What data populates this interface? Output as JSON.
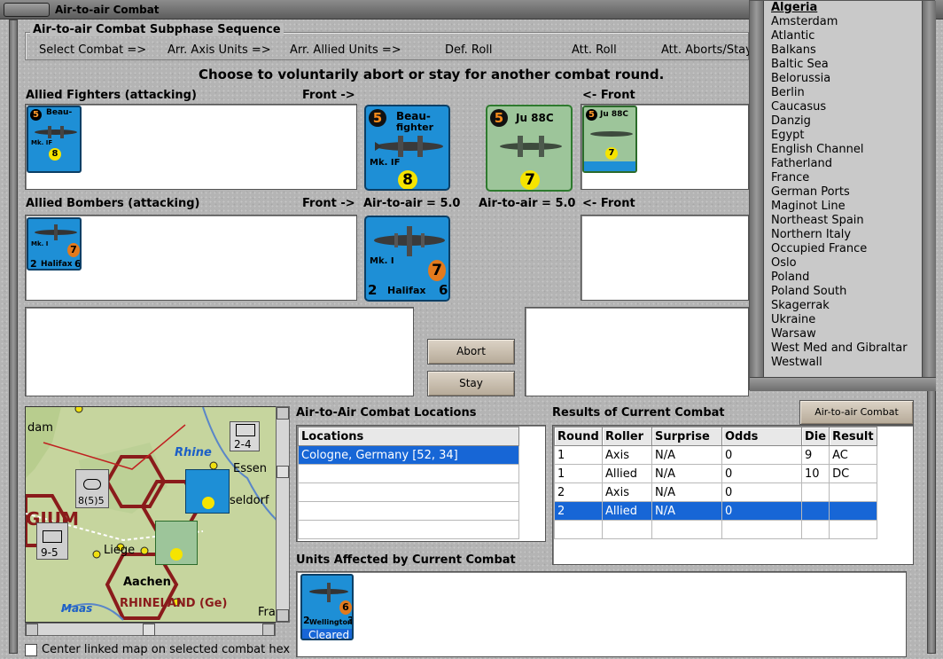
{
  "window": {
    "title": "Air-to-air Combat"
  },
  "sequence": {
    "legend": "Air-to-air Combat Subphase Sequence",
    "steps": [
      "Select Combat =>",
      "Arr. Axis Units =>",
      "Arr. Allied Units =>",
      "Def. Roll",
      "Att. Roll",
      "Att. Aborts/Stay"
    ]
  },
  "instruction": "Choose to voluntarily abort or stay for another combat round.",
  "allied_fighters": {
    "label": "Allied Fighters (attacking)",
    "front_label": "Front ->",
    "counter": {
      "name_line1": "Beau-",
      "name_line2": "fighter",
      "model": "Mk. IF",
      "rating": "5",
      "value": "8"
    }
  },
  "axis_fighter": {
    "front_label": "<- Front",
    "counter": {
      "name": "Ju 88C",
      "rating": "5",
      "value": "7"
    }
  },
  "allied_bombers": {
    "label": "Allied Bombers (attacking)",
    "front_label": "Front ->",
    "air_to_air_left": "Air-to-air = 5.0",
    "air_to_air_right": "Air-to-air = 5.0",
    "right_front_label": "<- Front",
    "counter": {
      "name": "Halifax",
      "model": "Mk. I",
      "left": "2",
      "right": "6",
      "value": "7"
    }
  },
  "buttons": {
    "abort": "Abort",
    "stay": "Stay",
    "chart": "Air-to-air Combat Chart"
  },
  "locations": {
    "title": "Air-to-Air Combat Locations",
    "header": "Locations",
    "rows": [
      "Cologne, Germany [52, 34]"
    ]
  },
  "results": {
    "title": "Results of Current Combat",
    "columns": [
      "Round",
      "Roller",
      "Surprise",
      "Odds",
      "Die",
      "Result"
    ],
    "rows": [
      [
        "1",
        "Axis",
        "N/A",
        "0",
        "9",
        "AC"
      ],
      [
        "1",
        "Allied",
        "N/A",
        "0",
        "10",
        "DC"
      ],
      [
        "2",
        "Axis",
        "N/A",
        "0",
        "",
        ""
      ],
      [
        "2",
        "Allied",
        "N/A",
        "0",
        "",
        ""
      ]
    ]
  },
  "units_affected": {
    "title": "Units Affected by Current Combat",
    "unit": {
      "name": "Wellington",
      "left": "2",
      "right": "3",
      "value": "6",
      "status": "Cleared"
    }
  },
  "map": {
    "labels": [
      "dam",
      "Rhine",
      "Essen",
      "seldorf",
      "Liege",
      "Aachen",
      "RHINELAND (Ge)",
      "Maas",
      "Fra",
      "GIUM"
    ],
    "stacks": [
      "2-4",
      "8(5)5",
      "9-5"
    ],
    "center_checkbox": "Center linked map on selected combat hex"
  },
  "dropdown": {
    "items": [
      "Algeria",
      "Amsterdam",
      "Atlantic",
      "Balkans",
      "Baltic Sea",
      "Belorussia",
      "Berlin",
      "Caucasus",
      "Danzig",
      "Egypt",
      "English Channel",
      "Fatherland",
      "France",
      "German Ports",
      "Maginot Line",
      "Northeast Spain",
      "Northern Italy",
      "Occupied France",
      "Oslo",
      "Poland",
      "Poland South",
      "Skagerrak",
      "Ukraine",
      "Warsaw",
      "West Med and Gibraltar",
      "Westwall"
    ]
  },
  "colors": {
    "counter_blue": "#1e8fd6",
    "selection_blue": "#1766d6",
    "axis_counter": "#9dc59a",
    "button_tan": "#cfc4b4"
  }
}
